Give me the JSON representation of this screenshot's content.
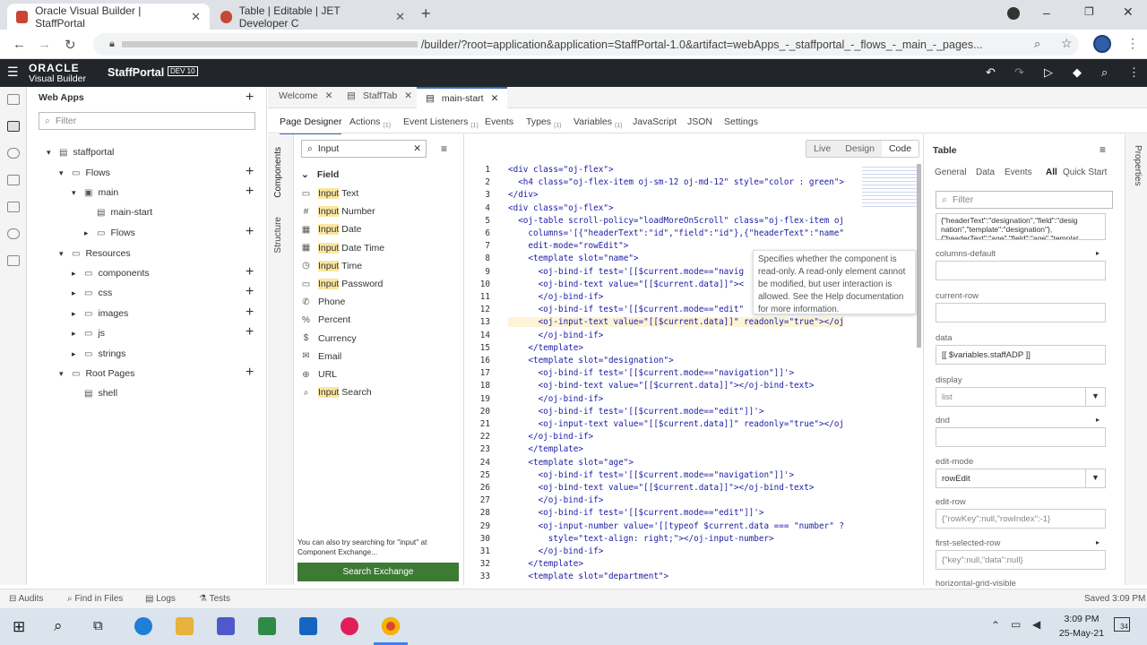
{
  "browser": {
    "tabs": [
      {
        "title": "Oracle Visual Builder | StaffPortal",
        "active": true,
        "color": "#c74634"
      },
      {
        "title": "Table | Editable | JET Developer C",
        "active": false,
        "color": "#c74634"
      }
    ],
    "url": "/builder/?root=application&application=StaffPortal-1.0&artifact=webApps_-_staffportal_-_flows_-_main_-_pages...",
    "new_tab": "+"
  },
  "app": {
    "brand_line1": "ORACLE",
    "brand_line2": "Visual Builder",
    "name": "StaffPortal",
    "badge": "DEV 10"
  },
  "tree": {
    "title": "Web Apps",
    "filter_placeholder": "Filter",
    "items": [
      {
        "label": "staffportal",
        "level": 0,
        "icon": "page-icon"
      },
      {
        "label": "Flows",
        "level": 1,
        "icon": "folder-icon",
        "add": true
      },
      {
        "label": "main",
        "level": 2,
        "icon": "flow-icon",
        "add": true
      },
      {
        "label": "main-start",
        "level": 3,
        "icon": "page-icon"
      },
      {
        "label": "Flows",
        "level": 3,
        "icon": "folder-icon",
        "add": true
      },
      {
        "label": "Resources",
        "level": 1,
        "icon": "folder-icon"
      },
      {
        "label": "components",
        "level": 2,
        "icon": "folder-icon",
        "add": true
      },
      {
        "label": "css",
        "level": 2,
        "icon": "folder-icon",
        "add": true
      },
      {
        "label": "images",
        "level": 2,
        "icon": "folder-icon",
        "add": true
      },
      {
        "label": "js",
        "level": 2,
        "icon": "folder-icon",
        "add": true
      },
      {
        "label": "strings",
        "level": 2,
        "icon": "folder-icon"
      },
      {
        "label": "Root Pages",
        "level": 1,
        "icon": "folder-icon",
        "add": true
      },
      {
        "label": "shell",
        "level": 2,
        "icon": "page-icon"
      }
    ]
  },
  "editor_tabs": [
    "Welcome",
    "StaffTab",
    "main-start"
  ],
  "sub_tabs": [
    {
      "label": "Page Designer",
      "count": ""
    },
    {
      "label": "Actions",
      "count": "(1)"
    },
    {
      "label": "Event Listeners",
      "count": "(1)"
    },
    {
      "label": "Events",
      "count": ""
    },
    {
      "label": "Types",
      "count": "(1)"
    },
    {
      "label": "Variables",
      "count": "(1)"
    },
    {
      "label": "JavaScript",
      "count": ""
    },
    {
      "label": "JSON",
      "count": ""
    },
    {
      "label": "Settings",
      "count": ""
    }
  ],
  "palette": {
    "search_value": "Input",
    "vertical_tabs": [
      "Components",
      "Structure"
    ],
    "group": "Field",
    "items": [
      {
        "hl": "Input",
        "rest": " Text",
        "icon": "▭"
      },
      {
        "hl": "Input",
        "rest": " Number",
        "icon": "#"
      },
      {
        "hl": "Input",
        "rest": " Date",
        "icon": "▦"
      },
      {
        "hl": "Input",
        "rest": " Date Time",
        "icon": "▦"
      },
      {
        "hl": "Input",
        "rest": " Time",
        "icon": "◷"
      },
      {
        "hl": "Input",
        "rest": " Password",
        "icon": "▭"
      },
      {
        "hl": "",
        "rest": "Phone",
        "icon": "✆"
      },
      {
        "hl": "",
        "rest": "Percent",
        "icon": "%"
      },
      {
        "hl": "",
        "rest": "Currency",
        "icon": "$"
      },
      {
        "hl": "",
        "rest": "Email",
        "icon": "✉"
      },
      {
        "hl": "",
        "rest": "URL",
        "icon": "⊕"
      },
      {
        "hl": "Input",
        "rest": " Search",
        "icon": "⌕"
      }
    ],
    "exchange_hint": "You can also try searching for \"input\" at Component Exchange...",
    "exchange_button": "Search Exchange"
  },
  "view_modes": [
    "Live",
    "Design",
    "Code"
  ],
  "code_lines": [
    "<div class=\"oj-flex\">",
    "  <h4 class=\"oj-flex-item oj-sm-12 oj-md-12\" style=\"color : green\">",
    "</div>",
    "<div class=\"oj-flex\">",
    "  <oj-table scroll-policy=\"loadMoreOnScroll\" class=\"oj-flex-item oj",
    "    columns='[{\"headerText\":\"id\",\"field\":\"id\"},{\"headerText\":\"name\"",
    "    edit-mode=\"rowEdit\">",
    "    <template slot=\"name\">",
    "      <oj-bind-if test='[[$current.mode==\"navig",
    "      <oj-bind-text value=\"[[$current.data]]\"><",
    "      </oj-bind-if>",
    "      <oj-bind-if test='[[$current.mode==\"edit\"",
    "      <oj-input-text value=\"[[$current.data]]\" readonly=\"true\"></oj",
    "      </oj-bind-if>",
    "    </template>",
    "    <template slot=\"designation\">",
    "      <oj-bind-if test='[[$current.mode==\"navigation\"]]'>",
    "      <oj-bind-text value=\"[[$current.data]]\"></oj-bind-text>",
    "      </oj-bind-if>",
    "      <oj-bind-if test='[[$current.mode==\"edit\"]]'>",
    "      <oj-input-text value=\"[[$current.data]]\" readonly=\"true\"></oj",
    "    </oj-bind-if>",
    "    </template>",
    "    <template slot=\"age\">",
    "      <oj-bind-if test='[[$current.mode==\"navigation\"]]'>",
    "      <oj-bind-text value=\"[[$current.data]]\"></oj-bind-text>",
    "      </oj-bind-if>",
    "      <oj-bind-if test='[[$current.mode==\"edit\"]]'>",
    "      <oj-input-number value='[[typeof $current.data === \"number\" ?",
    "        style=\"text-align: right;\"></oj-input-number>",
    "      </oj-bind-if>",
    "    </template>",
    "    <template slot=\"department\">"
  ],
  "tooltip": "Specifies whether the component is read-only. A read-only element cannot be modified, but user interaction is allowed. See the Help documentation for more information.",
  "properties": {
    "title": "Table",
    "rail_label": "Properties",
    "tabs": [
      "General",
      "Data",
      "Events",
      "All",
      "Quick Start"
    ],
    "filter_placeholder": "Filter",
    "columns_value": "{\"headerText\":\"designation\",\"field\":\"desig nation\",\"template\":\"designation\"},{\"headerText\":\"age\",\"field\":\"age\",\"templat",
    "fields": [
      {
        "label": "columns-default",
        "value": "",
        "expand": true
      },
      {
        "label": "current-row",
        "value": ""
      },
      {
        "label": "data",
        "value": "[[ $variables.staffADP ]]"
      },
      {
        "label": "display",
        "value": "list",
        "select": true
      },
      {
        "label": "dnd",
        "value": "",
        "expand": true
      },
      {
        "label": "edit-mode",
        "value": "rowEdit",
        "select": true
      },
      {
        "label": "edit-row",
        "value": "{\"rowKey\":null,\"rowIndex\":-1}"
      },
      {
        "label": "first-selected-row",
        "value": "{\"key\":null,\"data\":null}",
        "expand": true
      },
      {
        "label": "horizontal-grid-visible",
        "value": ""
      }
    ]
  },
  "footer": {
    "items": [
      "Audits",
      "Find in Files",
      "Logs",
      "Tests"
    ],
    "status": "Saved 3:09 PM"
  },
  "taskbar": {
    "time": "3:09 PM",
    "date": "25-May-21",
    "notifications": "34"
  }
}
